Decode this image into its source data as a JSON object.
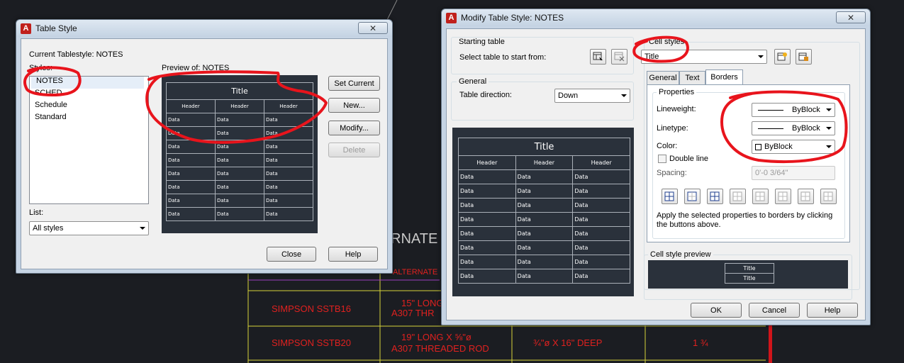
{
  "background": {
    "alternate_heading": "RNATE",
    "alternate_cell": "ALTERNATE",
    "row1_fastener": "SIMPSON SSTB16",
    "row1_desc_line1": "15\" LONG",
    "row1_desc_line2": "A307 THR",
    "row2_fastener": "SIMPSON SSTB20",
    "row2_desc_line1": "19\" LONG X ⅝\"ø",
    "row2_desc_line2": "A307 THREADED ROD",
    "row2_hole": "¾\"ø X 16\" DEEP",
    "row2_qty": "1 ¾",
    "colors": {
      "grid_yellow": "#d7d43a",
      "text_red": "#e0211f",
      "bg": "#1b1d22"
    }
  },
  "table_style_dialog": {
    "title": "Table Style",
    "close_symbol": "✕",
    "current_tablestyle": "Current Tablestyle: NOTES",
    "styles_label": "Styles:",
    "styles": [
      "NOTES",
      "SCHED",
      "Schedule",
      "Standard"
    ],
    "selected_style": "NOTES",
    "preview_label": "Preview of: NOTES",
    "list_label": "List:",
    "list_value": "All styles",
    "buttons": {
      "set_current": "Set Current",
      "new": "New...",
      "modify": "Modify...",
      "delete": "Delete",
      "close": "Close",
      "help": "Help"
    },
    "preview": {
      "title": "Title",
      "headers": [
        "Header",
        "Header",
        "Header"
      ],
      "cell": "Data"
    }
  },
  "modify_dialog": {
    "title": "Modify Table Style: NOTES",
    "close_symbol": "✕",
    "starting_table_label": "Starting table",
    "select_table_label": "Select table to start from:",
    "general_label": "General",
    "table_direction_label": "Table direction:",
    "table_direction_value": "Down",
    "cell_styles_label": "Cell styles",
    "cell_style_value": "Title",
    "tabs": [
      "General",
      "Text",
      "Borders"
    ],
    "active_tab": "Borders",
    "properties_label": "Properties",
    "lineweight_label": "Lineweight:",
    "lineweight_value": "ByBlock",
    "linetype_label": "Linetype:",
    "linetype_value": "ByBlock",
    "color_label": "Color:",
    "color_value": "ByBlock",
    "double_line_label": "Double line",
    "spacing_label": "Spacing:",
    "spacing_value": "0'-0 3/64\"",
    "apply_text": "Apply the selected properties to borders by clicking the buttons above.",
    "cell_style_preview_label": "Cell style preview",
    "cell_style_preview_cells": [
      "Title",
      "Title"
    ],
    "preview": {
      "title": "Title",
      "headers": [
        "Header",
        "Header",
        "Header"
      ],
      "cell": "Data"
    },
    "buttons": {
      "ok": "OK",
      "cancel": "Cancel",
      "help": "Help"
    }
  },
  "annotation_color": "#e8141c"
}
